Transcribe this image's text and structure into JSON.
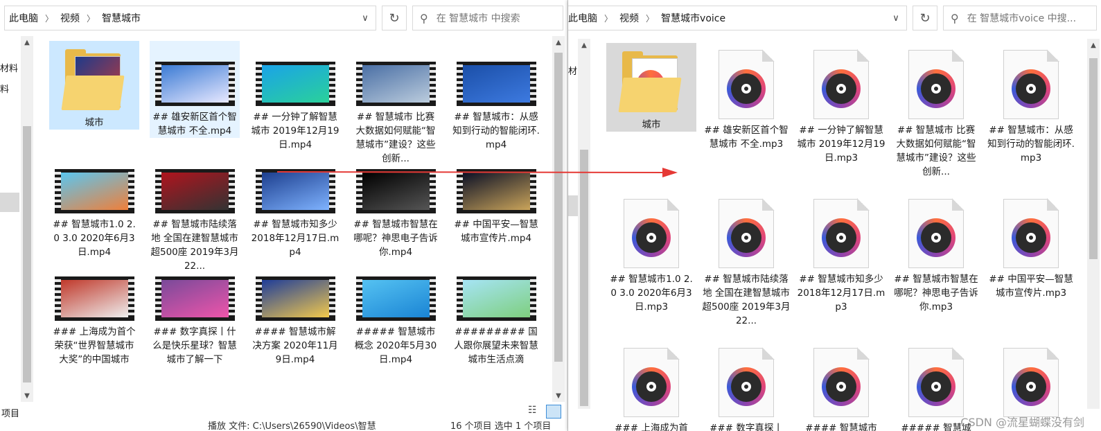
{
  "left": {
    "breadcrumb": [
      "此电脑",
      "视频",
      "智慧城市"
    ],
    "search_placeholder": "在 智慧城市 中搜索",
    "nav_fragments": [
      "材料",
      "料"
    ],
    "status_left": "项目",
    "status_bottom": "播放 文件:  C:\\Users\\26590\\Videos\\智慧",
    "status_mid": "16 个项目    选中 1 个项目",
    "items": [
      {
        "type": "folder",
        "label": "城市",
        "state": "sel",
        "thumb": [
          "#1e3a8a",
          "#c43a3a"
        ]
      },
      {
        "type": "video",
        "label": "## 雄安新区首个智慧城市 不全.mp4",
        "state": "hov",
        "thumb": [
          "#3b7bd4",
          "#e8e8ff"
        ]
      },
      {
        "type": "video",
        "label": "## 一分钟了解智慧城市 2019年12月19日.mp4",
        "state": "",
        "thumb": [
          "#1aa3e8",
          "#2ad19a"
        ]
      },
      {
        "type": "video",
        "label": "## 智慧城市 比赛  大数据如何赋能“智慧城市”建设？这些创新...",
        "state": "",
        "thumb": [
          "#4a6fa5",
          "#bcd"
        ]
      },
      {
        "type": "video",
        "label": "## 智慧城市：从感知到行动的智能闭环.mp4",
        "state": "",
        "thumb": [
          "#1b4fa8",
          "#3d7ae0"
        ]
      },
      {
        "type": "video",
        "label": "## 智慧城市1.0 2.0 3.0 2020年6月3日.mp4",
        "state": "",
        "thumb": [
          "#5bc6f0",
          "#ef7f3a"
        ]
      },
      {
        "type": "video",
        "label": "## 智慧城市陆续落地 全国在建智慧城市超500座 2019年3月22...",
        "state": "",
        "thumb": [
          "#b0141e",
          "#333"
        ]
      },
      {
        "type": "video",
        "label": "## 智慧城市知多少 2018年12月17日.mp4",
        "state": "",
        "thumb": [
          "#1d3f8f",
          "#7fb3ff"
        ]
      },
      {
        "type": "video",
        "label": "## 智慧城市智慧在哪呢？神思电子告诉你.mp4",
        "state": "",
        "thumb": [
          "#000",
          "#555"
        ]
      },
      {
        "type": "video",
        "label": "## 中国平安—智慧城市宣传片.mp4",
        "state": "",
        "thumb": [
          "#0b1026",
          "#caa45a"
        ]
      },
      {
        "type": "video",
        "label": "### 上海成为首个荣获“世界智慧城市大奖”的中国城市",
        "state": "",
        "thumb": [
          "#c0392b",
          "#eee"
        ]
      },
      {
        "type": "video",
        "label": "### 数字真探丨什么是快乐星球？智慧城市了解一下",
        "state": "",
        "thumb": [
          "#7a4a9a",
          "#e5a"
        ]
      },
      {
        "type": "video",
        "label": "#### 智慧城市解决方案 2020年11月9日.mp4",
        "state": "",
        "thumb": [
          "#1f3d99",
          "#f2c94c"
        ]
      },
      {
        "type": "video",
        "label": "##### 智慧城市概念 2020年5月30日.mp4",
        "state": "",
        "thumb": [
          "#55c2f2",
          "#1a84d4"
        ]
      },
      {
        "type": "video",
        "label": "######### 国人跟你展望未来智慧城市生活点滴",
        "state": "",
        "thumb": [
          "#a6e4f5",
          "#7ecf7e"
        ]
      }
    ]
  },
  "right": {
    "breadcrumb": [
      "此电脑",
      "视频",
      "智慧城市voice"
    ],
    "search_placeholder": "在 智慧城市voice 中搜...",
    "nav_fragments": [
      "材"
    ],
    "items": [
      {
        "type": "folder",
        "label": "城市",
        "state": "grey"
      },
      {
        "type": "mp3",
        "label": "## 雄安新区首个智慧城市 不全.mp3",
        "state": ""
      },
      {
        "type": "mp3",
        "label": "## 一分钟了解智慧城市 2019年12月19日.mp3",
        "state": ""
      },
      {
        "type": "mp3",
        "label": "## 智慧城市 比赛  大数据如何赋能“智慧城市”建设？这些创新...",
        "state": ""
      },
      {
        "type": "mp3",
        "label": "## 智慧城市：从感知到行动的智能闭环.mp3",
        "state": ""
      },
      {
        "type": "mp3",
        "label": "## 智慧城市1.0 2.0 3.0 2020年6月3日.mp3",
        "state": ""
      },
      {
        "type": "mp3",
        "label": "## 智慧城市陆续落地 全国在建智慧城市超500座 2019年3月22...",
        "state": ""
      },
      {
        "type": "mp3",
        "label": "## 智慧城市知多少 2018年12月17日.mp3",
        "state": ""
      },
      {
        "type": "mp3",
        "label": "## 智慧城市智慧在哪呢？神思电子告诉你.mp3",
        "state": ""
      },
      {
        "type": "mp3",
        "label": "## 中国平安—智慧城市宣传片.mp3",
        "state": ""
      },
      {
        "type": "mp3",
        "label": "### 上海成为首",
        "state": ""
      },
      {
        "type": "mp3",
        "label": "### 数字真探丨",
        "state": ""
      },
      {
        "type": "mp3",
        "label": "#### 智慧城市",
        "state": ""
      },
      {
        "type": "mp3",
        "label": "##### 智慧城",
        "state": ""
      },
      {
        "type": "mp3",
        "label": "",
        "state": ""
      }
    ]
  },
  "watermark": "CSDN @流星蝴蝶没有剑",
  "colors": {
    "selected": "#cce8ff",
    "hover": "#e5f3ff",
    "arrow": "#e53935"
  }
}
